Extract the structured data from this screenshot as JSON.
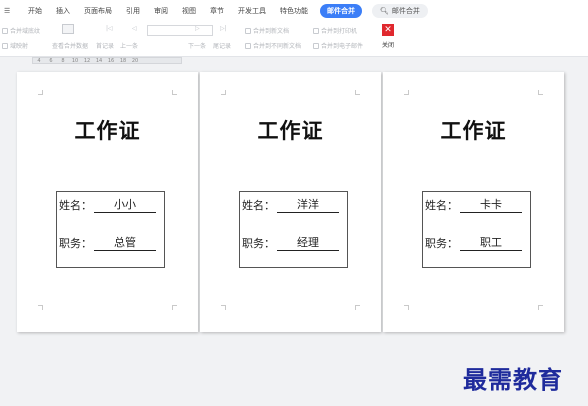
{
  "menu": {
    "items": [
      "开始",
      "插入",
      "页面布局",
      "引用",
      "审阅",
      "视图",
      "章节",
      "开发工具",
      "特色功能"
    ],
    "active_tab": "邮件合并",
    "search": "邮件合并"
  },
  "ribbon": {
    "buttons": [
      "合并域底纹",
      "插入合并域",
      "查看合并数据",
      "首记录",
      "上一条",
      "下一条",
      "尾记录",
      "合并到新文档",
      "合并到不同新文档",
      "合并到打印机",
      "合并到电子邮件",
      "关闭",
      "域映射"
    ]
  },
  "ruler": {
    "ticks": [
      "4",
      "6",
      "8",
      "10",
      "12",
      "14",
      "16",
      "18",
      "20"
    ]
  },
  "cards": [
    {
      "title": "工作证",
      "name_label": "姓名：",
      "name": "小小",
      "job_label": "职务：",
      "job": "总管"
    },
    {
      "title": "工作证",
      "name_label": "姓名：",
      "name": "洋洋",
      "job_label": "职务：",
      "job": "经理"
    },
    {
      "title": "工作证",
      "name_label": "姓名：",
      "name": "卡卡",
      "job_label": "职务：",
      "job": "职工"
    }
  ],
  "watermark": "最需教育",
  "colors": {
    "accent": "#3b7ef7",
    "close": "#e0282e",
    "watermark": "#1f2b9c",
    "workspace": "#f1f2f4"
  }
}
